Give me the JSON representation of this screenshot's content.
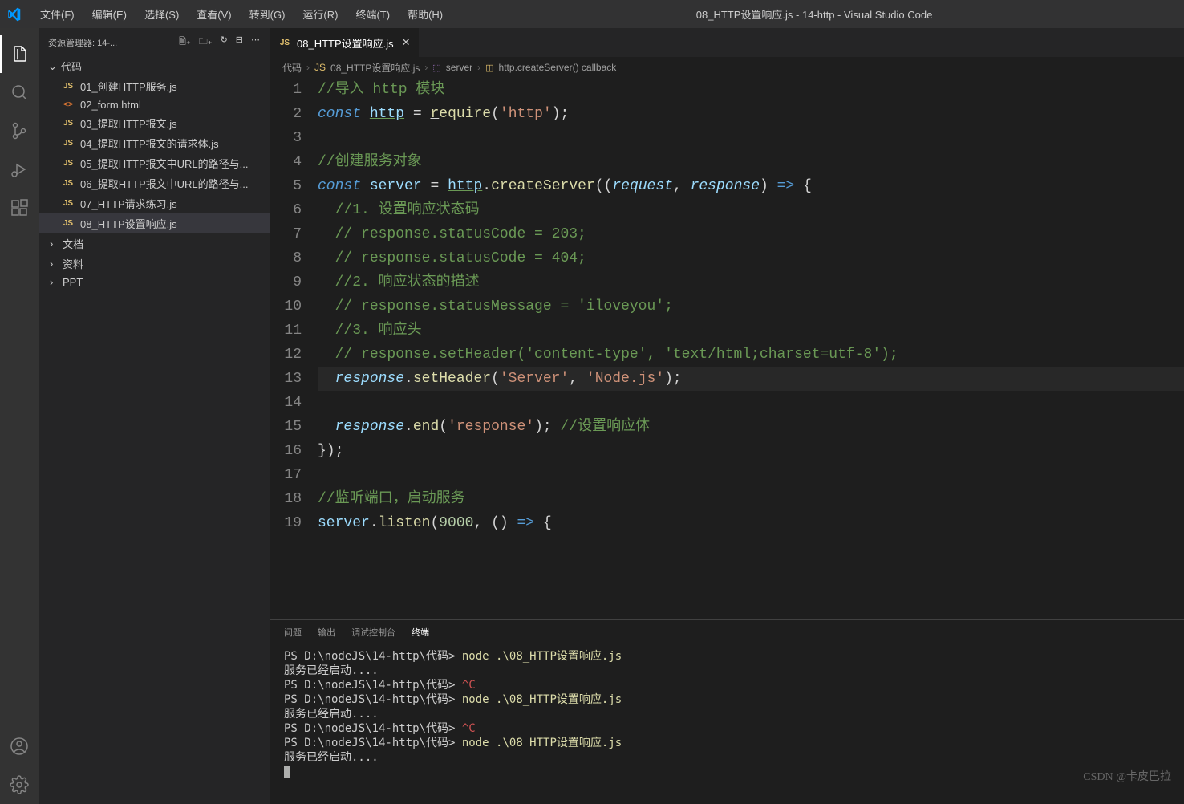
{
  "titlebar": {
    "title": "08_HTTP设置响应.js - 14-http - Visual Studio Code",
    "menus": [
      "文件(F)",
      "编辑(E)",
      "选择(S)",
      "查看(V)",
      "转到(G)",
      "运行(R)",
      "终端(T)",
      "帮助(H)"
    ]
  },
  "sidebar": {
    "header_label": "资源管理器: 14-...",
    "folders": {
      "root": "代码",
      "items": [
        {
          "icon": "JS",
          "name": "01_创建HTTP服务.js"
        },
        {
          "icon": "<>",
          "name": "02_form.html"
        },
        {
          "icon": "JS",
          "name": "03_提取HTTP报文.js"
        },
        {
          "icon": "JS",
          "name": "04_提取HTTP报文的请求体.js"
        },
        {
          "icon": "JS",
          "name": "05_提取HTTP报文中URL的路径与..."
        },
        {
          "icon": "JS",
          "name": "06_提取HTTP报文中URL的路径与..."
        },
        {
          "icon": "JS",
          "name": "07_HTTP请求练习.js"
        },
        {
          "icon": "JS",
          "name": "08_HTTP设置响应.js"
        }
      ],
      "closed": [
        "文档",
        "资料",
        "PPT"
      ]
    }
  },
  "tabs": {
    "active": {
      "icon": "JS",
      "label": "08_HTTP设置响应.js"
    }
  },
  "breadcrumb": {
    "p1": "代码",
    "p2": "08_HTTP设置响应.js",
    "p3": "server",
    "p4": "http.createServer() callback"
  },
  "code": {
    "lines": [
      1,
      2,
      3,
      4,
      5,
      6,
      7,
      8,
      9,
      10,
      11,
      12,
      13,
      14,
      15,
      16,
      17,
      18,
      19
    ],
    "l1_comment": "//导入 http 模块",
    "l2_const": "const",
    "l2_http": "http",
    "l2_require": "require",
    "l2_str": "'http'",
    "l4_comment": "//创建服务对象",
    "l5_const": "const",
    "l5_server": "server",
    "l5_http": "http",
    "l5_create": "createServer",
    "l5_req": "request",
    "l5_res": "response",
    "l6_comment": "//1. 设置响应状态码",
    "l7_comment": "// response.statusCode = 203;",
    "l8_comment": "// response.statusCode = 404;",
    "l9_comment": "//2. 响应状态的描述",
    "l10_comment": "// response.statusMessage = 'iloveyou';",
    "l11_comment": "//3. 响应头",
    "l12_comment": "// response.setHeader('content-type', 'text/html;charset=utf-8');",
    "l13_res": "response",
    "l13_set": "setHeader",
    "l13_s1": "'Server'",
    "l13_s2": "'Node.js'",
    "l15_res": "response",
    "l15_end": "end",
    "l15_str": "'response'",
    "l15_comment": "//设置响应体",
    "l18_comment": "//监听端口，启动服务",
    "l19_server": "server",
    "l19_listen": "listen",
    "l19_port": "9000"
  },
  "panel": {
    "tabs": [
      "问题",
      "输出",
      "调试控制台",
      "终端"
    ],
    "t_prompt": "PS D:\\nodeJS\\14-http\\代码>",
    "t_cmd": "node",
    "t_arg": ".\\08_HTTP设置响应.js",
    "t_ctrl": "^C",
    "t_started": "服务已经启动....",
    "watermark": "CSDN @卡皮巴拉"
  }
}
